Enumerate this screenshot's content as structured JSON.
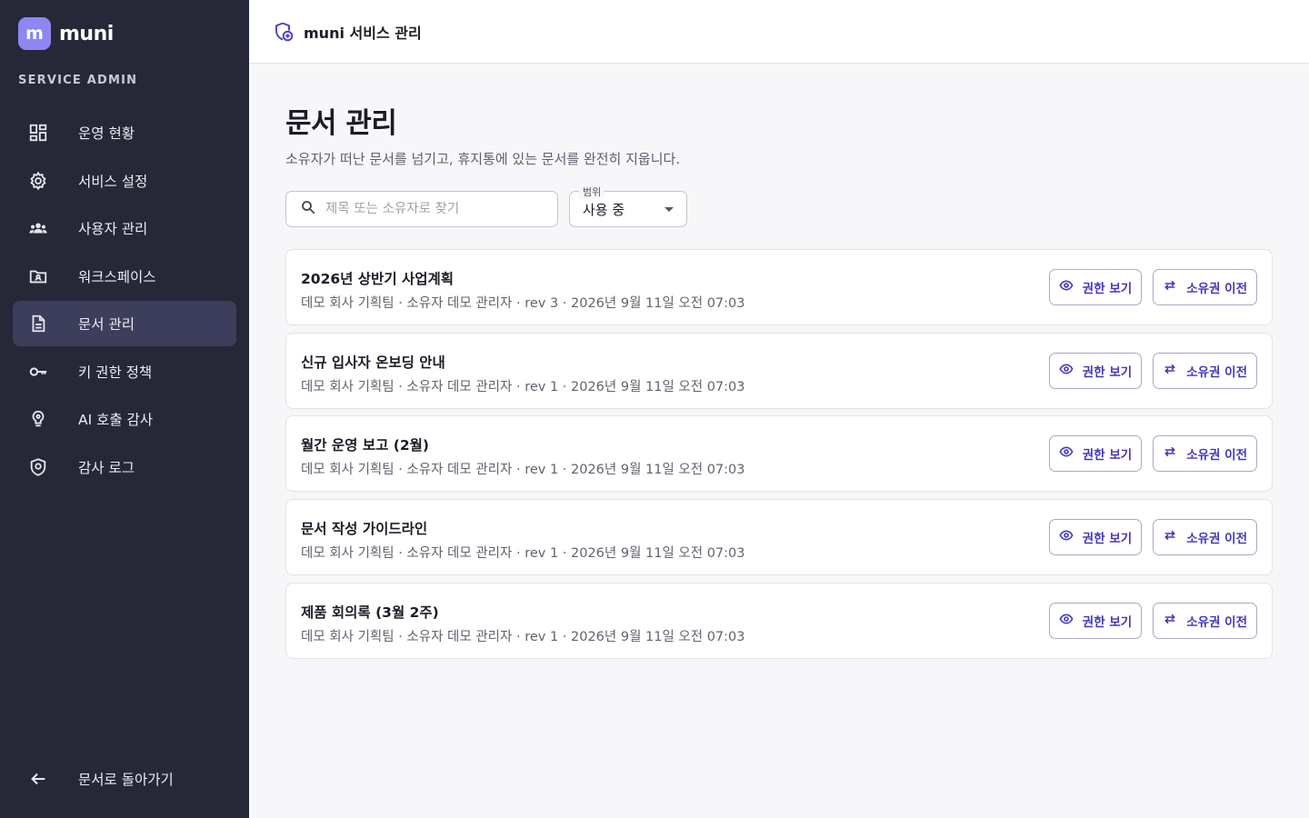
{
  "sidebar": {
    "logo_letter": "m",
    "brand": "muni",
    "section_label": "SERVICE ADMIN",
    "items": [
      {
        "label": "운영 현황",
        "icon": "dashboard-icon"
      },
      {
        "label": "서비스 설정",
        "icon": "gear-icon"
      },
      {
        "label": "사용자 관리",
        "icon": "users-icon"
      },
      {
        "label": "워크스페이스",
        "icon": "workspace-folder-icon"
      },
      {
        "label": "문서 관리",
        "icon": "document-icon",
        "active": true
      },
      {
        "label": "키 권한 정책",
        "icon": "key-icon"
      },
      {
        "label": "AI 호출 감사",
        "icon": "ai-audit-icon"
      },
      {
        "label": "감사 로그",
        "icon": "shield-icon"
      }
    ],
    "back_label": "문서로 돌아가기"
  },
  "header": {
    "title": "muni 서비스 관리"
  },
  "main": {
    "title": "문서 관리",
    "description": "소유자가 떠난 문서를 넘기고, 휴지통에 있는 문서를 완전히 지웁니다.",
    "search_placeholder": "제목 또는 소유자로 찾기",
    "scope_legend": "범위",
    "scope_value": "사용 중",
    "view_permissions_label": "권한 보기",
    "transfer_ownership_label": "소유권 이전",
    "documents": [
      {
        "title": "2026년 상반기 사업계획",
        "meta": "데모 회사 기획팀 · 소유자 데모 관리자 · rev 3 · 2026년 9월 11일 오전 07:03"
      },
      {
        "title": "신규 입사자 온보딩 안내",
        "meta": "데모 회사 기획팀 · 소유자 데모 관리자 · rev 1 · 2026년 9월 11일 오전 07:03"
      },
      {
        "title": "월간 운영 보고 (2월)",
        "meta": "데모 회사 기획팀 · 소유자 데모 관리자 · rev 1 · 2026년 9월 11일 오전 07:03"
      },
      {
        "title": "문서 작성 가이드라인",
        "meta": "데모 회사 기획팀 · 소유자 데모 관리자 · rev 1 · 2026년 9월 11일 오전 07:03"
      },
      {
        "title": "제품 회의록 (3월 2주)",
        "meta": "데모 회사 기획팀 · 소유자 데모 관리자 · rev 1 · 2026년 9월 11일 오전 07:03"
      }
    ]
  },
  "colors": {
    "sidebar_bg": "#262838",
    "active_item_bg": "#3c3e5c",
    "brand_accent": "#8f86f2",
    "button_text": "#4338b8"
  }
}
